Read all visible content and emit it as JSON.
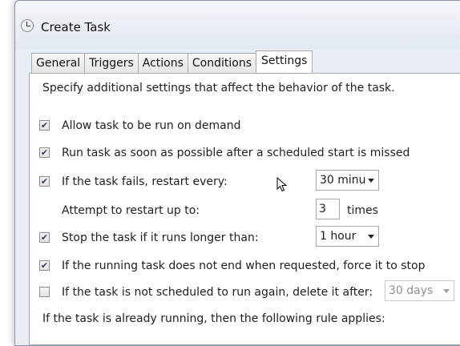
{
  "window": {
    "title": "Create Task",
    "icon": "clock-icon"
  },
  "tabs": [
    {
      "label": "General"
    },
    {
      "label": "Triggers"
    },
    {
      "label": "Actions"
    },
    {
      "label": "Conditions"
    },
    {
      "label": "Settings",
      "active": true
    }
  ],
  "settings": {
    "description": "Specify additional settings that affect the behavior of the task.",
    "allow_on_demand": {
      "label": "Allow task to be run on demand",
      "checked": true
    },
    "run_asap": {
      "label": "Run task as soon as possible after a scheduled start is missed",
      "checked": true
    },
    "restart_on_fail": {
      "label": "If the task fails, restart every:",
      "checked": true,
      "value": "30 minu"
    },
    "restart_attempts": {
      "label": "Attempt to restart up to:",
      "value": "3",
      "unit": "times"
    },
    "stop_if_long": {
      "label": "Stop the task if it runs longer than:",
      "checked": true,
      "value": "1 hour"
    },
    "force_stop": {
      "label": "If the running task does not end when requested, force it to stop",
      "checked": true
    },
    "delete_after": {
      "label": "If the task is not scheduled to run again, delete it after:",
      "checked": false,
      "value": "30 days"
    },
    "running_rule": {
      "label": "If the task is already running, then the following rule applies:"
    }
  },
  "check_glyph": "✔"
}
